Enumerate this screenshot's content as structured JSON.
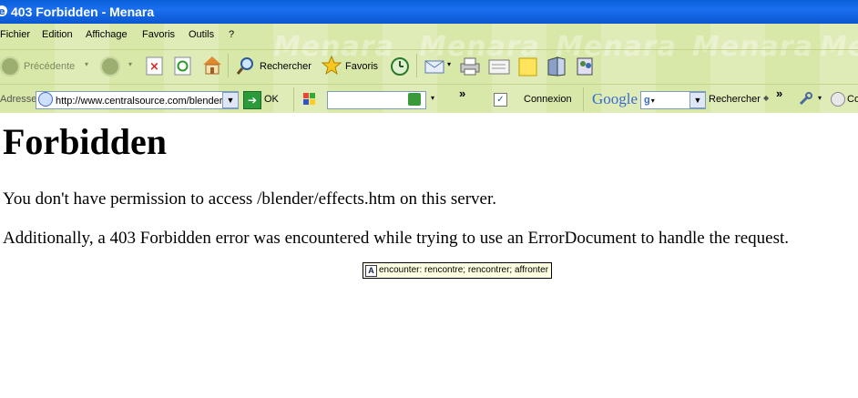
{
  "window": {
    "title": "403 Forbidden - Menara"
  },
  "watermark_text": "Menara",
  "menu": [
    "Fichier",
    "Edition",
    "Affichage",
    "Favoris",
    "Outils",
    "?"
  ],
  "toolbar": {
    "back_label": "Précédente",
    "search_label": "Rechercher",
    "favorites_label": "Favoris"
  },
  "address_bar": {
    "label": "Adresse",
    "url": "http://www.centralsource.com/blender",
    "go_label": "OK"
  },
  "links_chevron": "»",
  "connexion_label": "Connexion",
  "google": {
    "logo": "Google",
    "search_label": "Rechercher"
  },
  "page": {
    "heading": "Forbidden",
    "paragraph1": "You don't have permission to access /blender/effects.htm on this server.",
    "paragraph2": "Additionally, a 403 Forbidden error was encountered while trying to use an ErrorDocument to handle the request."
  },
  "tooltip": {
    "text": "encounter: rencontre; rencontrer; affronter",
    "icon_glyph": "A"
  },
  "colors": {
    "titlebar": "#0a5fd8",
    "chrome": "#d8e8a8",
    "tooltip_bg": "#ffffe1"
  }
}
